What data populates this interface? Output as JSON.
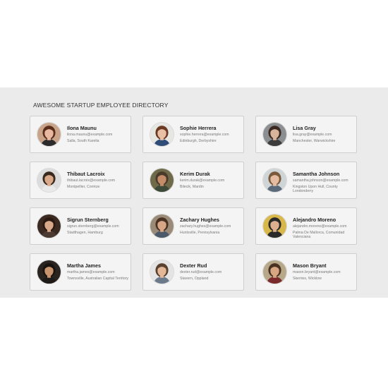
{
  "directory": {
    "title": "AWESOME STARTUP EMPLOYEE DIRECTORY",
    "employees": [
      {
        "name": "Ilona Maunu",
        "email": "ilona.maunu@example.com",
        "location": "Salla, South Karelia",
        "avatar": {
          "bg": "#c9a38a",
          "hair": "#5a2e1a",
          "skin": "#e8b9a0",
          "shirt": "#2b2b2b"
        }
      },
      {
        "name": "Sophie Herrera",
        "email": "sophie.herrera@example.com",
        "location": "Edinburgh, Derbyshire",
        "avatar": {
          "bg": "#e6e6e2",
          "hair": "#6b3a22",
          "skin": "#e9bfa6",
          "shirt": "#2f4c78"
        }
      },
      {
        "name": "Lisa Gray",
        "email": "lisa.gray@example.com",
        "location": "Manchester, Warwickshire",
        "avatar": {
          "bg": "#8c8f91",
          "hair": "#3a2a22",
          "skin": "#d9b49c",
          "shirt": "#3c3c3c"
        }
      },
      {
        "name": "Thibaut Lacroix",
        "email": "thibaut.lacroix@example.com",
        "location": "Montpellier, Corrèze",
        "avatar": {
          "bg": "#dcdcdc",
          "hair": "#3a2a1e",
          "skin": "#d9a98a",
          "shirt": "#e9e9e9"
        }
      },
      {
        "name": "Kerim Durak",
        "email": "kerim.durak@example.com",
        "location": "Bilecik, Mardin",
        "avatar": {
          "bg": "#6e6a4a",
          "hair": "#4a3a2a",
          "skin": "#c48d6a",
          "shirt": "#3d4a3a"
        }
      },
      {
        "name": "Samantha Johnson",
        "email": "samantha.johnson@example.com",
        "location": "Kingston Upon Hull, County Londonderry",
        "avatar": {
          "bg": "#cfd4d6",
          "hair": "#7a5a3a",
          "skin": "#e4bca2",
          "shirt": "#5a6a7a"
        }
      },
      {
        "name": "Sigrun Sternberg",
        "email": "sigrun.sternberg@example.com",
        "location": "Stadthagen, Hamburg",
        "avatar": {
          "bg": "#3a2a22",
          "hair": "#2a1a12",
          "skin": "#d8a88a",
          "shirt": "#4a3a32"
        }
      },
      {
        "name": "Zachary Hughes",
        "email": "zachary.hughes@example.com",
        "location": "Huntsville, Pennsylvania",
        "avatar": {
          "bg": "#9a8a78",
          "hair": "#4a3222",
          "skin": "#d6a686",
          "shirt": "#4a5a6a"
        }
      },
      {
        "name": "Alejandro Moreno",
        "email": "alejandro.moreno@example.com",
        "location": "Palma De Mallorca, Comunidad Valenciana",
        "avatar": {
          "bg": "#d8b84a",
          "hair": "#2a2a2a",
          "skin": "#dcb08e",
          "shirt": "#2a2a2a"
        }
      },
      {
        "name": "Martha James",
        "email": "martha.james@example.com",
        "location": "Townsville, Australian Capital Territory",
        "avatar": {
          "bg": "#2a2420",
          "hair": "#1a1410",
          "skin": "#c8946e",
          "shirt": "#1e1a18"
        }
      },
      {
        "name": "Dexter Rud",
        "email": "dexter.rud@example.com",
        "location": "Stavern, Oppland",
        "avatar": {
          "bg": "#e4e4e4",
          "hair": "#5a4230",
          "skin": "#e2b898",
          "shirt": "#6a7a8a"
        }
      },
      {
        "name": "Mason Bryant",
        "email": "mason.bryant@example.com",
        "location": "Skerries, Wicklow",
        "avatar": {
          "bg": "#b8a88a",
          "hair": "#4a3222",
          "skin": "#d9a682",
          "shirt": "#7a2a2a"
        }
      }
    ]
  }
}
